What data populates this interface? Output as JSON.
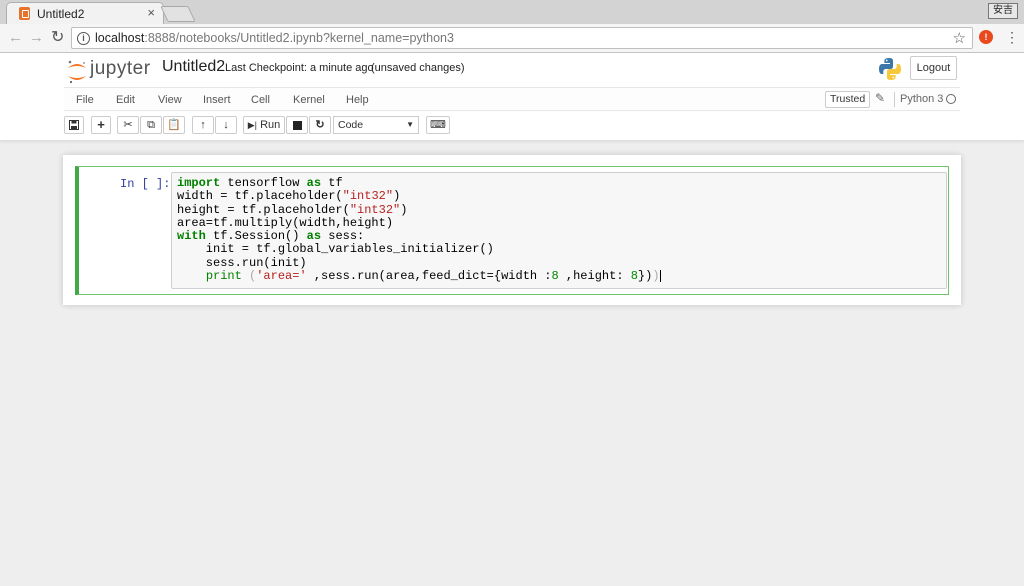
{
  "browser": {
    "tab_title": "Untitled2",
    "tab_close": "×",
    "ime_label": "安吉",
    "url_host": "localhost",
    "url_rest": ":8888/notebooks/Untitled2.ipynb?kernel_name=python3"
  },
  "header": {
    "logo_text": "jupyter",
    "notebook_name": "Untitled2",
    "checkpoint": "Last Checkpoint: a minute ago",
    "unsaved": "(unsaved changes)",
    "logout": "Logout"
  },
  "menu": {
    "items": [
      "File",
      "Edit",
      "View",
      "Insert",
      "Cell",
      "Kernel",
      "Help"
    ],
    "trusted": "Trusted",
    "kernel": "Python 3"
  },
  "toolbar": {
    "run": "Run",
    "cell_type": "Code"
  },
  "cell": {
    "prompt": "In [ ]:",
    "code": [
      "import tensorflow as tf",
      "width = tf.placeholder(\"int32\")",
      "height = tf.placeholder(\"int32\")",
      "area=tf.multiply(width,height)",
      "with tf.Session() as sess:",
      "    init = tf.global_variables_initializer()",
      "    sess.run(init)",
      "    print ('area=' ,sess.run(area,feed_dict={width :8 ,height: 8}))"
    ]
  },
  "colors": {
    "accent_orange": "#F37626",
    "cell_border": "#42A948",
    "keyword": "#008000",
    "string": "#BA2121"
  }
}
